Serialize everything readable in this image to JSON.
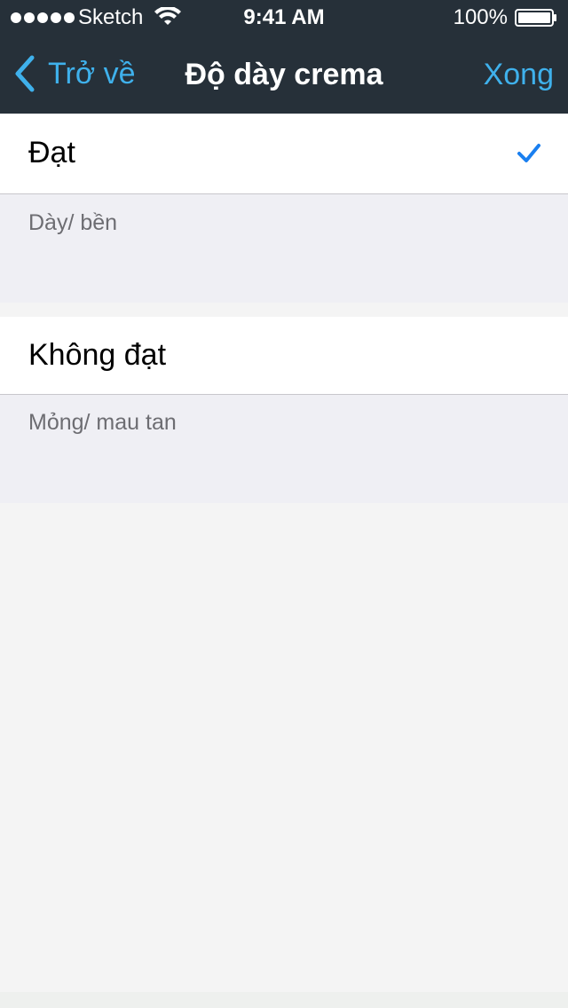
{
  "status_bar": {
    "carrier": "Sketch",
    "time": "9:41 AM",
    "battery_percent": "100%",
    "signal_bars": 5,
    "icons": [
      "signal-dots",
      "wifi-icon",
      "battery-icon"
    ]
  },
  "navbar": {
    "back_label": "Trở về",
    "title": "Độ dày crema",
    "done_label": "Xong",
    "back_icon": "chevron-left-icon"
  },
  "options": [
    {
      "label": "Đạt",
      "description": "Dày/ bền",
      "selected": true
    },
    {
      "label": "Không đạt",
      "description": "Mỏng/ mau tan",
      "selected": false
    }
  ],
  "colors": {
    "navbar_bg": "#263039",
    "accent": "#3fb1ec",
    "checkmark": "#1a7ff0",
    "group_bg": "#efeff4",
    "page_bg": "#f4f4f4",
    "footer_text": "#6d6d72"
  }
}
